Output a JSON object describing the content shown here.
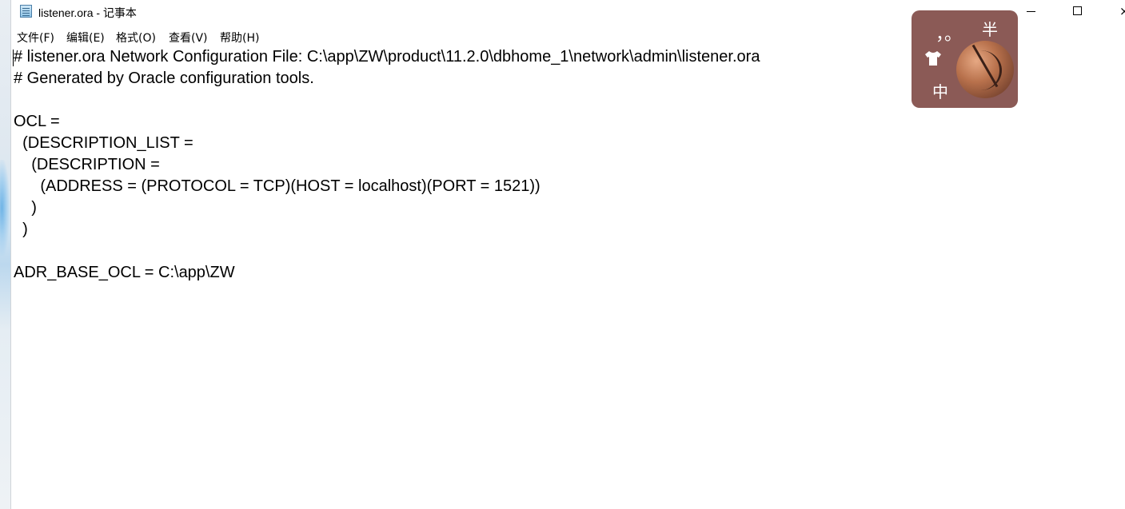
{
  "window": {
    "title": "listener.ora - 记事本"
  },
  "menu": {
    "items": [
      {
        "label": "文件(F)"
      },
      {
        "label": "编辑(E)"
      },
      {
        "label": "格式(O)"
      },
      {
        "label": "查看(V)"
      },
      {
        "label": "帮助(H)"
      }
    ]
  },
  "controls": {
    "minimize_icon": "minimize-icon",
    "maximize_icon": "maximize-icon",
    "close_icon": "close-icon",
    "close_glyph": "×"
  },
  "editor": {
    "lines": [
      "# listener.ora Network Configuration File: C:\\app\\ZW\\product\\11.2.0\\dbhome_1\\network\\admin\\listener.ora",
      "# Generated by Oracle configuration tools.",
      "",
      "OCL =",
      "  (DESCRIPTION_LIST =",
      "    (DESCRIPTION =",
      "      (ADDRESS = (PROTOCOL = TCP)(HOST = localhost)(PORT = 1521))",
      "    )",
      "  )",
      "",
      "ADR_BASE_OCL = C:\\app\\ZW"
    ]
  },
  "ime": {
    "punct": "，。",
    "half": "半",
    "lang": "中",
    "bg_color": "#8b5a56"
  }
}
